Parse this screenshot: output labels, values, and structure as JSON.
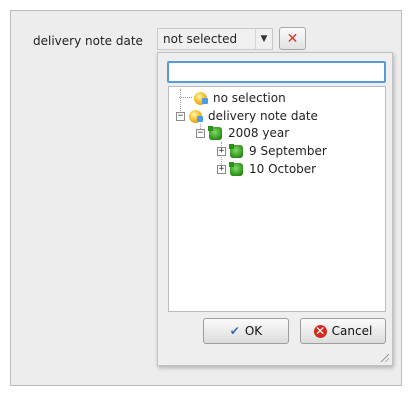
{
  "field": {
    "label": "delivery note date",
    "combo_value": "not selected",
    "combo_arrow": "▼",
    "clear_icon": "✕"
  },
  "popup": {
    "search_value": "",
    "tree": [
      {
        "label": "no selection",
        "icon": "yellow-folder-icon"
      },
      {
        "label": "delivery note date",
        "icon": "yellow-folder-icon",
        "expanded": true
      },
      {
        "label": "2008 year",
        "icon": "green-folder-icon",
        "expanded": true
      },
      {
        "label": "9 September",
        "icon": "green-folder-icon",
        "expanded": false
      },
      {
        "label": "10 October",
        "icon": "green-folder-icon",
        "expanded": false
      }
    ],
    "expander_collapsed": "+",
    "expander_expanded": "−",
    "ok_label": "OK",
    "ok_icon": "✔",
    "cancel_label": "Cancel",
    "cancel_icon": "✕"
  },
  "colors": {
    "search_focus_border": "#5b9bd5",
    "clear_icon": "#d9331f",
    "cancel_icon_bg": "#d22b1d"
  }
}
